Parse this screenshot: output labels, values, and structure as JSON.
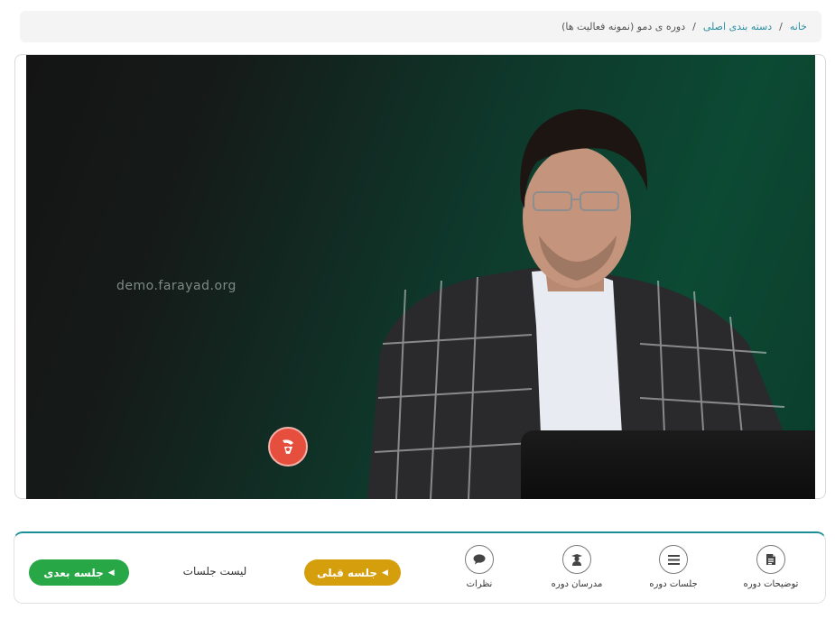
{
  "breadcrumb": {
    "home": "خانه",
    "category": "دسته بندی اصلی",
    "current": "دوره ی دمو (نمونه فعالیت ها)",
    "separator": "/"
  },
  "video": {
    "watermark": "demo.farayad.org",
    "logo_icon": "farayad-logo-icon"
  },
  "nav": {
    "description": "توضیحات دوره",
    "sessions": "جلسات دوره",
    "teachers": "مدرسان دوره",
    "comments": "نظرات"
  },
  "buttons": {
    "prev": "جلسه قبلی",
    "next": "جلسه بعدی",
    "sessions_list": "لیست جلسات"
  },
  "colors": {
    "link": "#2c8ea3",
    "prev_button": "#d59e0c",
    "next_button": "#27a745",
    "panel_accent": "#1c8e95"
  }
}
